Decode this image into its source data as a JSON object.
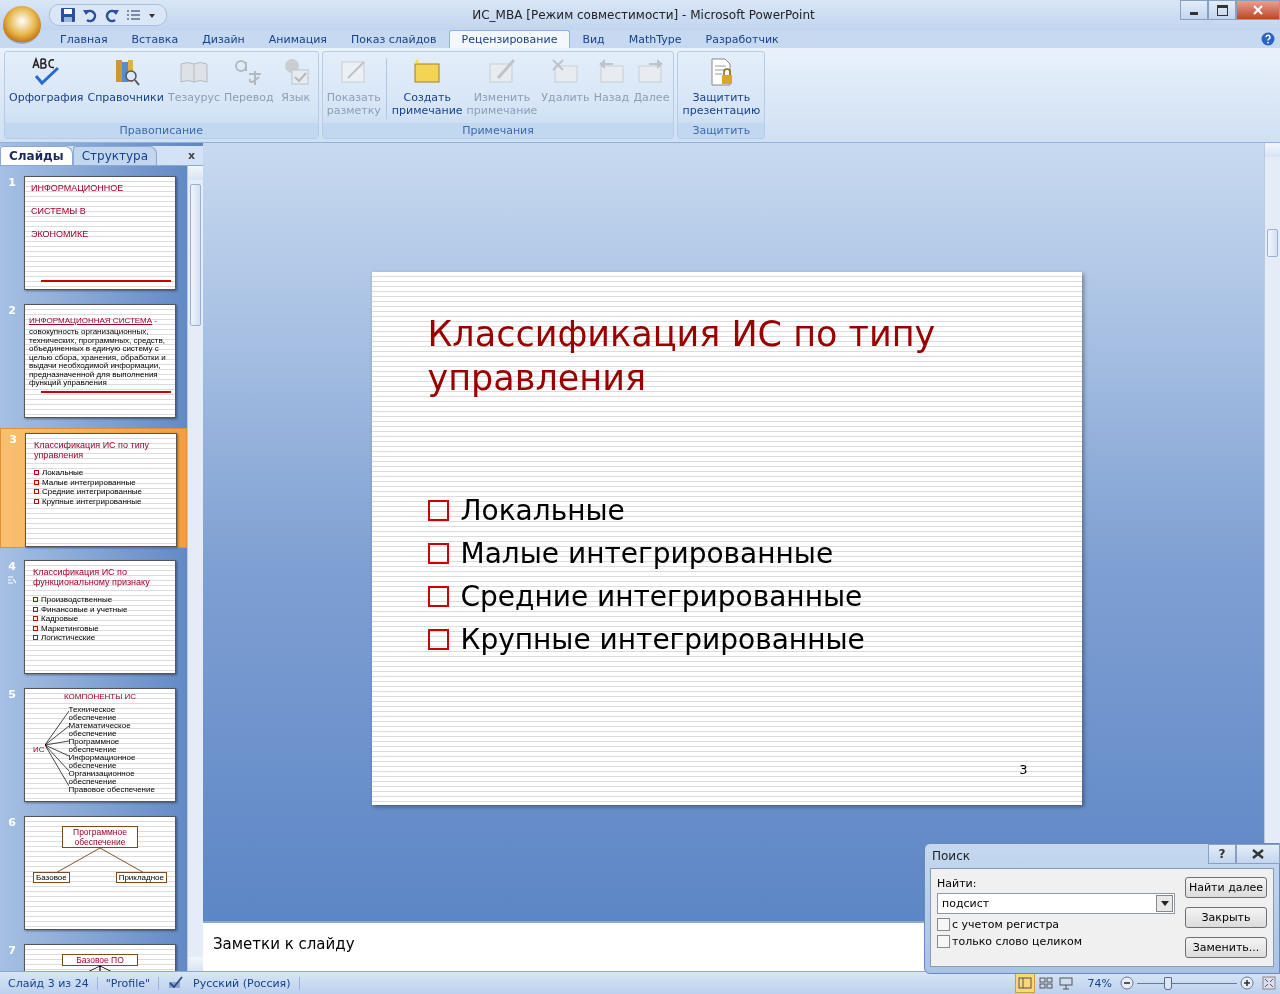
{
  "window": {
    "title": "ИС_MBA [Режим совместимости] - Microsoft PowerPoint"
  },
  "ribbon": {
    "tabs": [
      {
        "label": "Главная",
        "selected": false
      },
      {
        "label": "Вставка",
        "selected": false
      },
      {
        "label": "Дизайн",
        "selected": false
      },
      {
        "label": "Анимация",
        "selected": false
      },
      {
        "label": "Показ слайдов",
        "selected": false
      },
      {
        "label": "Рецензирование",
        "selected": true
      },
      {
        "label": "Вид",
        "selected": false
      },
      {
        "label": "MathType",
        "selected": false
      },
      {
        "label": "Разработчик",
        "selected": false
      }
    ],
    "groups": [
      {
        "label": "Правописание",
        "buttons": [
          {
            "label": "Орфография",
            "disabled": false
          },
          {
            "label": "Справочники",
            "disabled": false
          },
          {
            "label": "Тезаурус",
            "disabled": true
          },
          {
            "label": "Перевод",
            "disabled": true
          },
          {
            "label": "Язык",
            "disabled": true
          }
        ]
      },
      {
        "label": "Примечания",
        "buttons": [
          {
            "label": "Показать разметку",
            "disabled": true
          },
          {
            "label": "Создать примечание",
            "disabled": false
          },
          {
            "label": "Изменить примечание",
            "disabled": true
          },
          {
            "label": "Удалить",
            "disabled": true
          },
          {
            "label": "Назад",
            "disabled": true
          },
          {
            "label": "Далее",
            "disabled": true
          }
        ]
      },
      {
        "label": "Защитить",
        "buttons": [
          {
            "label": "Защитить презентацию",
            "disabled": false
          }
        ]
      }
    ]
  },
  "slide_panel": {
    "tabs": [
      {
        "label": "Слайды",
        "selected": true
      },
      {
        "label": "Структура",
        "selected": false
      }
    ],
    "close": "x",
    "slides": [
      {
        "number": "1",
        "selected": false,
        "animated": false,
        "kind": "title",
        "lines": [
          "ИНФОРМАЦИОННОЕ",
          "СИСТЕМЫ В",
          "ЭКОНОМИКЕ"
        ]
      },
      {
        "number": "2",
        "selected": false,
        "animated": false,
        "kind": "definition",
        "heading": "ИНФОРМАЦИОННАЯ СИСТЕМА",
        "dash": " -",
        "body": "совокупность организационных, технических, программных, средств, объединенных в единую систему с целью сбора, хранения, обработки и выдачи необходимой информации, предназначенной для выполнения функций управления"
      },
      {
        "number": "3",
        "selected": true,
        "animated": false,
        "kind": "bullets",
        "title": "Классификация ИС по типу управления",
        "items": [
          "Локальные",
          "Малые интегрированные",
          "Средние интегрированные",
          "Крупные интегрированные"
        ]
      },
      {
        "number": "4",
        "selected": false,
        "animated": true,
        "kind": "bullets",
        "title": "Классификация ИС по функциональному признаку",
        "items": [
          "Производственные",
          "Финансовые и учетные",
          "Кадровые",
          "Маркетинговые",
          "Логистические"
        ]
      },
      {
        "number": "5",
        "selected": false,
        "animated": false,
        "kind": "spokes",
        "title": "КОМПОНЕНТЫ    ИС",
        "center": "ИС",
        "items": [
          "Техническое обеспечение",
          "Математическое обеспечение",
          "Программное обеспечение",
          "Информационное обеспечение",
          "Организационное обеспечение",
          "Правовое  обеспечение"
        ]
      },
      {
        "number": "6",
        "selected": false,
        "animated": false,
        "kind": "tree",
        "root": "Программное обеспечение",
        "children": [
          "Базовое",
          "Прикладное"
        ]
      },
      {
        "number": "7",
        "selected": false,
        "animated": false,
        "kind": "tree",
        "root": "Базовое ПО"
      }
    ]
  },
  "slide": {
    "title": "Классификация ИС по типу управления",
    "bullets": [
      "Локальные",
      "Малые интегрированные",
      "Средние интегрированные",
      "Крупные интегрированные"
    ],
    "number": "3"
  },
  "notes": {
    "placeholder": "Заметки к слайду"
  },
  "find_dialog": {
    "title": "Поиск",
    "help": "?",
    "find_label": "Найти:",
    "value": "подсист",
    "options": [
      {
        "label": "с учетом регистра",
        "checked": false
      },
      {
        "label": "только слово целиком",
        "checked": false
      }
    ],
    "buttons": [
      "Найти далее",
      "Закрыть",
      "Заменить..."
    ]
  },
  "status_bar": {
    "slide_info": "Слайд 3 из 24",
    "theme": "\"Profile\"",
    "language": "Русский (Россия)",
    "zoom": "74%",
    "level": 0.3
  }
}
